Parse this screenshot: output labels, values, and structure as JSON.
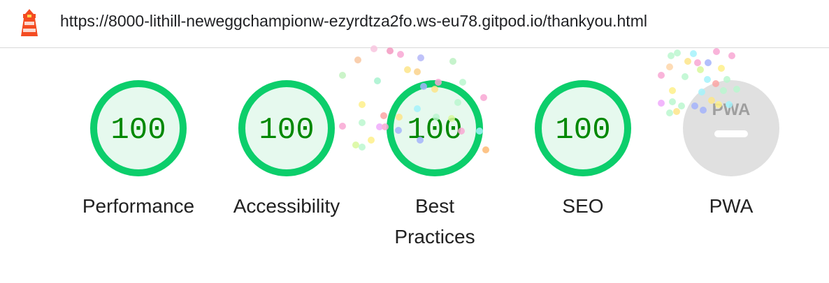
{
  "address_bar": {
    "url": "https://8000-lithill-neweggchampionw-ezyrdtza2fo.ws-eu78.gitpod.io/thankyou.html",
    "logo_icon": "lighthouse-icon"
  },
  "gauges": [
    {
      "score": "100",
      "label": "Performance",
      "color": "#0cce6b"
    },
    {
      "score": "100",
      "label": "Accessibility",
      "color": "#0cce6b"
    },
    {
      "score": "100",
      "label_line1": "Best",
      "label_line2": "Practices",
      "color": "#0cce6b"
    },
    {
      "score": "100",
      "label": "SEO",
      "color": "#0cce6b"
    },
    {
      "mark": "PWA",
      "label": "PWA",
      "color": "#e0e0e0"
    }
  ],
  "colors": {
    "pass_ring": "#0cce6b",
    "pass_fill": "#e6f9ee",
    "pass_text": "#008800",
    "pwa_fill": "#e0e0e0"
  }
}
